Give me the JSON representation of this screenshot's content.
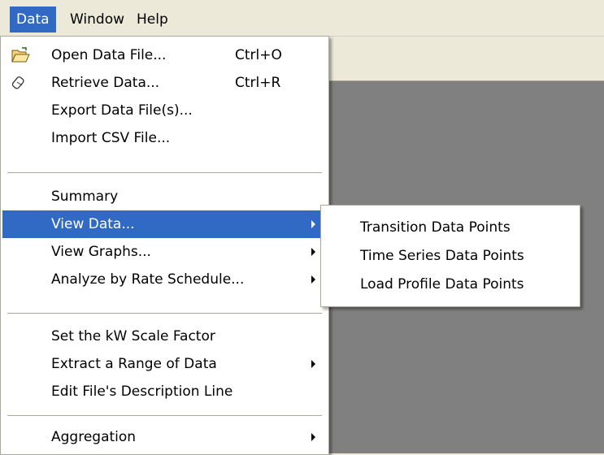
{
  "menubar": {
    "items": [
      {
        "label": "Data"
      },
      {
        "label": "Window"
      },
      {
        "label": "Help"
      }
    ]
  },
  "data_menu": {
    "open": {
      "label": "Open Data File...",
      "shortcut": "Ctrl+O",
      "icon": "open-folder-icon"
    },
    "retrieve": {
      "label": "Retrieve Data...",
      "shortcut": "Ctrl+R",
      "icon": "retrieve-icon"
    },
    "export": {
      "label": "Export Data File(s)..."
    },
    "import": {
      "label": "Import CSV File..."
    },
    "summary": {
      "label": "Summary"
    },
    "view_data": {
      "label": "View Data..."
    },
    "view_graphs": {
      "label": "View Graphs..."
    },
    "analyze": {
      "label": "Analyze by Rate Schedule..."
    },
    "kw_scale": {
      "label": "Set the kW Scale Factor"
    },
    "extract": {
      "label": "Extract a Range of Data"
    },
    "edit_desc": {
      "label": "Edit File's Description Line"
    },
    "aggregation": {
      "label": "Aggregation"
    }
  },
  "view_data_submenu": {
    "items": [
      {
        "label": "Transition Data Points"
      },
      {
        "label": "Time Series Data Points"
      },
      {
        "label": "Load Profile Data Points"
      }
    ]
  },
  "colors": {
    "highlight": "#316AC5",
    "menu_bg": "#FFFFFF",
    "chrome": "#ECE9D8",
    "workspace": "#808080"
  }
}
